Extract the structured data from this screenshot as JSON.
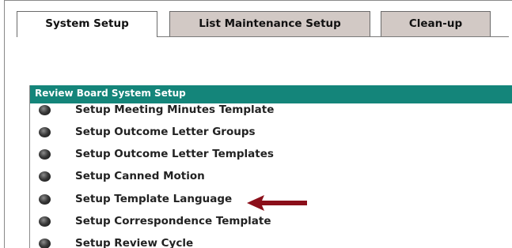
{
  "tabs": [
    {
      "label": "System Setup",
      "active": true
    },
    {
      "label": "List Maintenance Setup",
      "active": false
    },
    {
      "label": "Clean-up",
      "active": false
    }
  ],
  "section": {
    "title": "Review Board System Setup"
  },
  "items": [
    {
      "label": "Setup Meeting Minutes Template"
    },
    {
      "label": "Setup Outcome Letter Groups"
    },
    {
      "label": "Setup Outcome Letter Templates"
    },
    {
      "label": "Setup Canned Motion"
    },
    {
      "label": "Setup Template Language"
    },
    {
      "label": "Setup Correspondence Template"
    },
    {
      "label": "Setup Review Cycle"
    }
  ],
  "colors": {
    "header_bg": "#14857a",
    "inactive_tab_bg": "#d2c9c5",
    "arrow": "#8b0f1a"
  },
  "annotation": {
    "arrow_icon": "left-arrow-icon"
  }
}
